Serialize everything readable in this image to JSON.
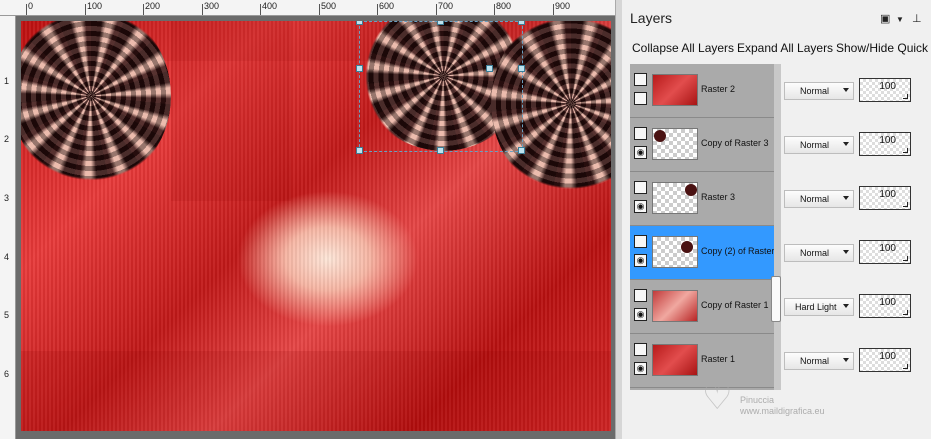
{
  "rulers": {
    "top_ticks": [
      "0",
      "100",
      "200",
      "300",
      "400",
      "500",
      "600",
      "700",
      "800",
      "900"
    ],
    "left_ticks": [
      "1",
      "1",
      "2",
      "3",
      "4",
      "5",
      "6"
    ]
  },
  "panel": {
    "title": "Layers",
    "dock_icon": "dock-icon",
    "pin_icon": "pin-icon"
  },
  "toolbar": {
    "collapse_all": "Collapse All Layers",
    "expand_all": "Expand All Layers",
    "show_hide": "Show/Hide Quick S"
  },
  "layers": [
    {
      "name": "Raster 2",
      "blend": "Normal",
      "opacity": "100",
      "visible": false,
      "selected": false
    },
    {
      "name": "Copy of Raster 3",
      "blend": "Normal",
      "opacity": "100",
      "visible": true,
      "selected": false
    },
    {
      "name": "Raster 3",
      "blend": "Normal",
      "opacity": "100",
      "visible": true,
      "selected": false
    },
    {
      "name": "Copy (2) of Raster",
      "blend": "Normal",
      "opacity": "100",
      "visible": true,
      "selected": true
    },
    {
      "name": "Copy of Raster 1",
      "blend": "Hard Light",
      "opacity": "100",
      "visible": true,
      "selected": false
    },
    {
      "name": "Raster 1",
      "blend": "Normal",
      "opacity": "100",
      "visible": true,
      "selected": false
    }
  ],
  "watermark": {
    "name": "Pinuccia",
    "url": "www.maildigrafica.eu"
  },
  "colors": {
    "selected_row": "#3399ff",
    "layers_bg": "#aaaaaa",
    "canvas_red": "#c41212"
  }
}
